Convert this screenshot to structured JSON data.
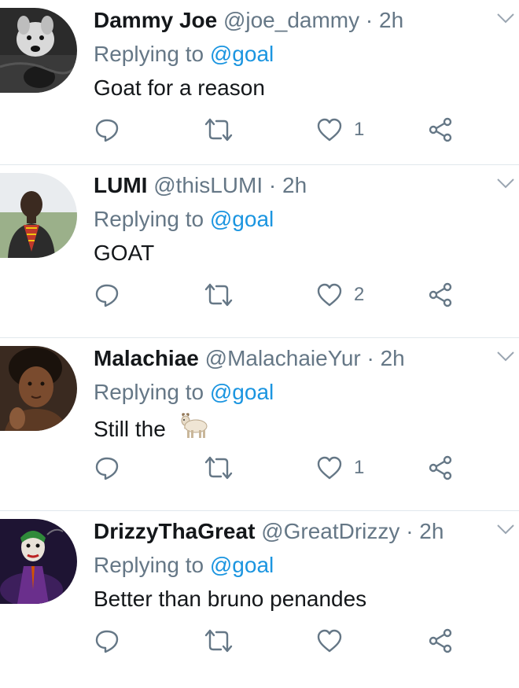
{
  "colors": {
    "name": "#14171a",
    "meta": "#657786",
    "mention": "#1b95e0",
    "divider": "#e1e8ed"
  },
  "tweets": [
    {
      "name": "Dammy Joe",
      "handle": "@joe_dammy",
      "time": "· 2h",
      "replying_prefix": "Replying to",
      "replying_to": "@goal",
      "text": "Goat for a reason",
      "likes": "1",
      "avatar": "avatar-dog"
    },
    {
      "name": "LUMI",
      "handle": "@thisLUMI",
      "time": "· 2h",
      "replying_prefix": "Replying to",
      "replying_to": "@goal",
      "text": "GOAT",
      "likes": "2",
      "avatar": "avatar-person"
    },
    {
      "name": "Malachiae",
      "handle": "@MalachaieYur",
      "time": "· 2h",
      "replying_prefix": "Replying to",
      "replying_to": "@goal",
      "text": "Still the",
      "emoji": "goat-emoji",
      "likes": "1",
      "avatar": "avatar-person"
    },
    {
      "name": "DrizzyThaGreat",
      "handle": "@GreatDrizzy",
      "time": "· 2h",
      "replying_prefix": "Replying to",
      "replying_to": "@goal",
      "text": "Better than bruno penandes",
      "likes": "",
      "avatar": "avatar-joker"
    }
  ]
}
